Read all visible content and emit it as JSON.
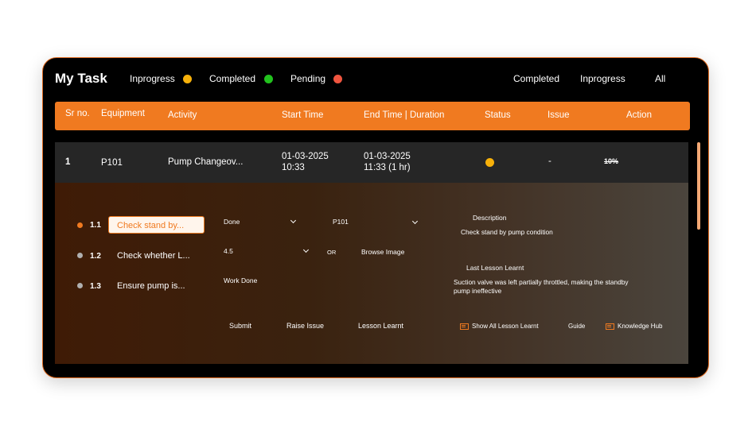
{
  "header": {
    "title": "My Task",
    "legend": [
      {
        "label": "Inprogress",
        "color": "#f7b10a"
      },
      {
        "label": "Completed",
        "color": "#22c21e"
      },
      {
        "label": "Pending",
        "color": "#f0553f"
      }
    ],
    "filters": [
      "Completed",
      "Inprogress",
      "All"
    ]
  },
  "table": {
    "columns": [
      "Sr no.",
      "Equipment",
      "Activity",
      "Start Time",
      "End Time | Duration",
      "Status",
      "Issue",
      "Action"
    ],
    "row": {
      "sr_no": "1",
      "equipment": "P101",
      "activity": "Pump Changeov...",
      "start_date": "01-03-2025",
      "start_time": "10:33",
      "end_date": "01-03-2025",
      "end_time": "11:33 (1 hr)",
      "status_color": "#f7b10a",
      "issue": "-",
      "action": "10%"
    }
  },
  "detail": {
    "subtasks": [
      {
        "num": "1.1",
        "text": "Check stand by...",
        "dot_color": "#f07a20",
        "active": true
      },
      {
        "num": "1.2",
        "text": "Check whether L...",
        "dot_color": "#b0b0b0",
        "active": false
      },
      {
        "num": "1.3",
        "text": "Ensure pump is...",
        "dot_color": "#b0b0b0",
        "active": false
      }
    ],
    "status_select": "Done",
    "equipment_select": "P101",
    "value_select": "4.5",
    "or_label": "OR",
    "browse_image": "Browse Image",
    "work_done_label": "Work Done",
    "description_title": "Description",
    "description_text": "Check stand by pump condition",
    "lesson_title": "Last Lesson Learnt",
    "lesson_text_line1": "Suction valve was left partially throttled, making the standby",
    "lesson_text_line2": "pump ineffective",
    "buttons": {
      "submit": "Submit",
      "raise_issue": "Raise Issue",
      "lesson_learnt": "Lesson Learnt",
      "show_all": "Show All Lesson Learnt",
      "guide": "Guide",
      "knowledge_hub": "Knowledge Hub"
    }
  }
}
